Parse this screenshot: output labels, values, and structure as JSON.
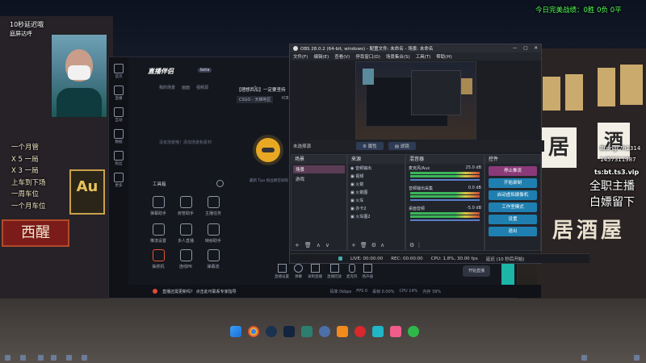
{
  "overlay": {
    "delay_notice": "10秒延迟哦",
    "delay_sub": "庭屏达呼",
    "stats_label": "今日完美战绩：",
    "stats_value": "0胜 0负 0平",
    "right_user": "Btongr7h1314",
    "right_phone": "1457311987",
    "ts": "ts:bt.ts3.vip",
    "slogan_1": "全职主播",
    "slogan_2": "白嫖留下",
    "left_list": [
      "一个月管",
      "X 5 一局",
      "X 3 一局",
      "上车到下场",
      "一周车位",
      "一个月车位"
    ]
  },
  "street_signs": {
    "sign_1": "居",
    "sign_2": "酒",
    "sign_3": "居酒屋",
    "sign_4": "西醒",
    "au_label": "Au"
  },
  "assistant": {
    "logo": "直播伴侣",
    "logo_badge": "beta",
    "tabs": [
      "我的场景",
      "画面",
      "视频源"
    ],
    "scene_title": "【理想西瓜】一定要坚持",
    "scene_sub": "CSGO - 天梯地区",
    "scene_tag": "ICB",
    "empty_hint": "没有场景哦！添加场景和素材",
    "right_hint": "最新 Tips 粉丝刷空间呢",
    "tools_header": "工具箱",
    "tools": [
      "弹幕助手",
      "房管助手",
      "主播任务",
      "推流设置",
      "多人直播",
      "映射助手",
      "抽奖机",
      "连线PK",
      "弹幕流"
    ],
    "sidebar": [
      "首页",
      "直播",
      "互动",
      "数据",
      "粉丝",
      "更多"
    ],
    "bottom_tools": [
      "直播设置",
      "弹幕",
      "录制直播",
      "直播回放",
      "麦克风",
      "扬声器"
    ],
    "start_btn": "开始直播",
    "footer_notice": "直播还需更新吗？ 点击此可联系专家指导",
    "footer_stats": [
      "码率 0kbps",
      "FPS 0",
      "丢帧 0.00%",
      "CPU 14%",
      "内存 39%"
    ]
  },
  "obs": {
    "title": "OBS 28.0.2 (64-bit, windows) - 配置文件: 未命名 - 场景: 未命名",
    "menu": [
      "文件(F)",
      "编辑(E)",
      "查看(V)",
      "停靠窗口(D)",
      "场景集合(S)",
      "工具(T)",
      "帮助(H)"
    ],
    "source_bar_label": "未选择源",
    "prop_btn": "属性",
    "filter_btn": "滤镜",
    "docks": {
      "scenes": {
        "title": "场景",
        "items": [
          "场景",
          "游戏"
        ]
      },
      "sources": {
        "title": "来源",
        "items": [
          "音频输出",
          "视频",
          "火箭",
          "火箭图",
          "火车",
          "办卡2",
          "火车图2"
        ]
      },
      "mixer": {
        "title": "混音器",
        "channels": [
          {
            "name": "麦克风/Aux",
            "db": "25.0 dB"
          },
          {
            "name": "音频输出采集",
            "db": "0.0 dB"
          },
          {
            "name": "桌面音频",
            "db": "-5.0 dB"
          }
        ]
      },
      "controls": {
        "title": "控件",
        "buttons": [
          "停止推流",
          "开始录制",
          "启动虚拟摄像机",
          "工作室模式",
          "设置",
          "退出"
        ]
      }
    },
    "status": {
      "live": "LIVE: 00:00:00",
      "rec": "REC: 00:00:00",
      "cpu": "CPU: 1.8%, 30.00 fps",
      "extra": "延迟 (10 秒后开始)"
    }
  },
  "taskbar": {
    "apps": [
      "windows",
      "chrome",
      "steam",
      "steam-alt",
      "edge",
      "media",
      "netease",
      "qq",
      "wps",
      "bilibili",
      "wechat"
    ]
  }
}
